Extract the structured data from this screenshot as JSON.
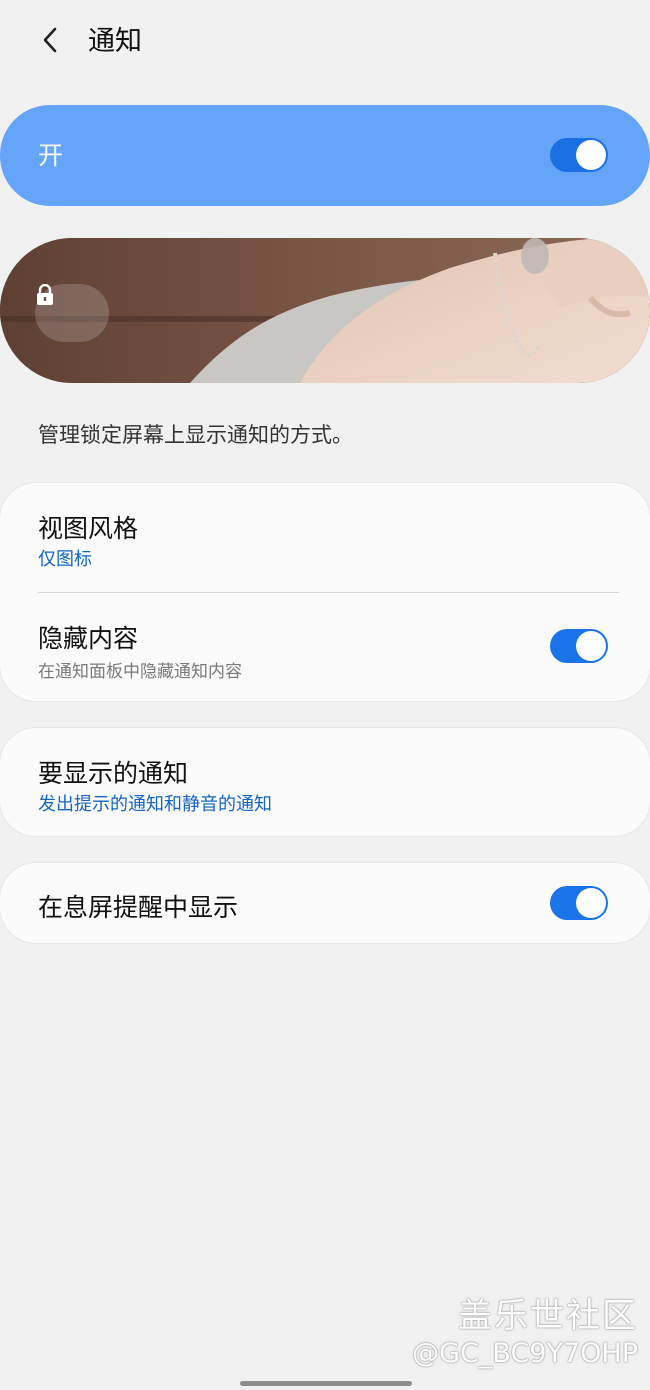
{
  "header": {
    "title": "通知",
    "back_icon": "chevron-left-icon"
  },
  "master": {
    "label": "开",
    "enabled": true,
    "bar_color": "#64a5fa"
  },
  "preview": {
    "lock_icon": "lock-icon"
  },
  "description": "管理锁定屏幕上显示通知的方式。",
  "card1": {
    "view_style": {
      "title": "视图风格",
      "value": "仅图标"
    },
    "hide_content": {
      "title": "隐藏内容",
      "subtitle": "在通知面板中隐藏通知内容",
      "enabled": true
    }
  },
  "card2": {
    "notifications_to_show": {
      "title": "要显示的通知",
      "value": "发出提示的通知和静音的通知"
    }
  },
  "card3": {
    "aod": {
      "title": "在息屏提醒中显示",
      "enabled": true
    }
  },
  "watermark": {
    "title": "盖乐世社区",
    "handle": "@GC_BC9Y7OHP"
  },
  "colors": {
    "accent": "#1a73e8",
    "link": "#1565c0",
    "background": "#f1f1f1"
  }
}
